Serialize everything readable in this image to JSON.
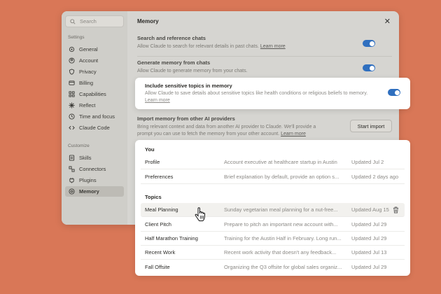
{
  "sidebar": {
    "search_placeholder": "Search",
    "settings_label": "Settings",
    "settings_items": [
      {
        "label": "General",
        "icon": "sliders-icon"
      },
      {
        "label": "Account",
        "icon": "user-circle-icon"
      },
      {
        "label": "Privacy",
        "icon": "shield-icon"
      },
      {
        "label": "Billing",
        "icon": "credit-card-icon"
      },
      {
        "label": "Capabilities",
        "icon": "grid-icon"
      },
      {
        "label": "Reflect",
        "icon": "sparkle-icon"
      },
      {
        "label": "Time and focus",
        "icon": "clock-icon"
      },
      {
        "label": "Claude Code",
        "icon": "code-icon"
      }
    ],
    "customize_label": "Customize",
    "customize_items": [
      {
        "label": "Skills",
        "icon": "skills-icon"
      },
      {
        "label": "Connectors",
        "icon": "connectors-icon"
      },
      {
        "label": "Plugins",
        "icon": "plugin-icon"
      },
      {
        "label": "Memory",
        "icon": "memory-icon",
        "active": true
      }
    ]
  },
  "main": {
    "title": "Memory",
    "settings": [
      {
        "title": "Search and reference chats",
        "desc": "Allow Claude to search for relevant details in past chats.",
        "link": "Learn more",
        "enabled": true
      },
      {
        "title": "Generate memory from chats",
        "desc": "Allow Claude to generate memory from your chats.",
        "enabled": true
      }
    ],
    "sensitive": {
      "title": "Include sensitive topics in memory",
      "desc": "Allow Claude to save details about sensitive topics like health conditions or religious beliefs to memory.",
      "link": "Learn more",
      "enabled": true
    },
    "import": {
      "title": "Import memory from other AI providers",
      "desc": "Bring relevant context and data from another AI provider to Claude. We'll provide a prompt you can use to fetch the memory from your other account.",
      "link": "Learn more",
      "button": "Start import"
    }
  },
  "memory": {
    "you_header": "You",
    "you_rows": [
      {
        "name": "Profile",
        "desc": "Account executive  at healthcare startup in Austin",
        "updated": "Updated Jul 2"
      },
      {
        "name": "Preferences",
        "desc": "Brief explanation by default, provide an option s...",
        "updated": "Updated 2 days ago"
      }
    ],
    "topics_header": "Topics",
    "topic_rows": [
      {
        "name": "Meal Planning",
        "desc": "Sunday vegetarian meal planning for a nut-free...",
        "updated": "Updated Aug 15"
      },
      {
        "name": "Client Pitch",
        "desc": "Prepare to pitch an important new account with...",
        "updated": "Updated Jul 29"
      },
      {
        "name": "Half Marathon Training",
        "desc": "Training for the Austin Half in February. Long run...",
        "updated": "Updated Jul 29"
      },
      {
        "name": "Recent Work",
        "desc": "Recent work activity that doesn't any feedback...",
        "updated": "Updated Jul 13"
      },
      {
        "name": "Fall Offsite",
        "desc": "Organizing the Q3 offsite for global sales organiz...",
        "updated": "Updated Jul 29"
      }
    ]
  },
  "colors": {
    "background": "#d97757",
    "toggle": "#2f6fbf",
    "window": "#d6d5d1"
  }
}
